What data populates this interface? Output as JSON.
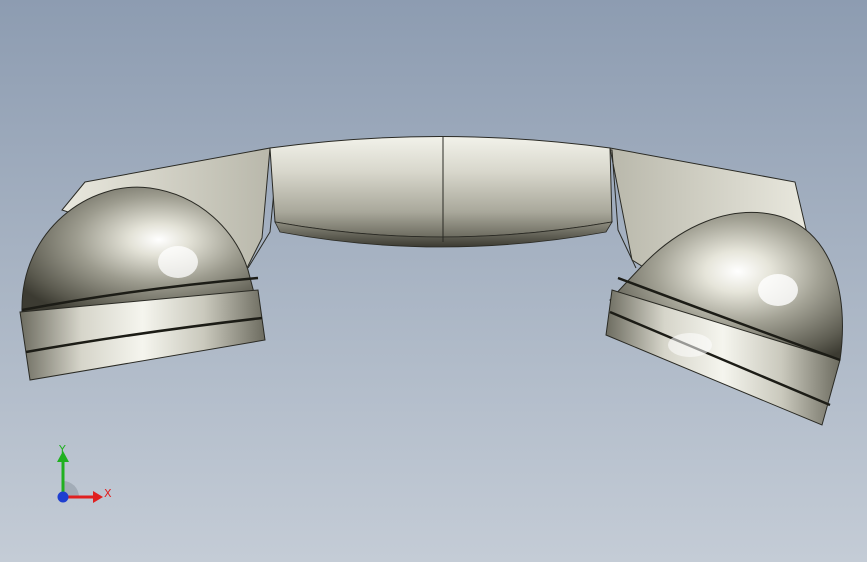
{
  "viewport": {
    "background_top": "#8d9cb1",
    "background_bottom": "#c4ccd6"
  },
  "model": {
    "name": "telephone-handset",
    "surface_color": "#c9c8bd",
    "edge_color": "#2a2a24"
  },
  "triad": {
    "x_label": "X",
    "y_label": "Y",
    "x_color": "#e02020",
    "y_color": "#20b020",
    "z_color": "#1f3fd0"
  }
}
